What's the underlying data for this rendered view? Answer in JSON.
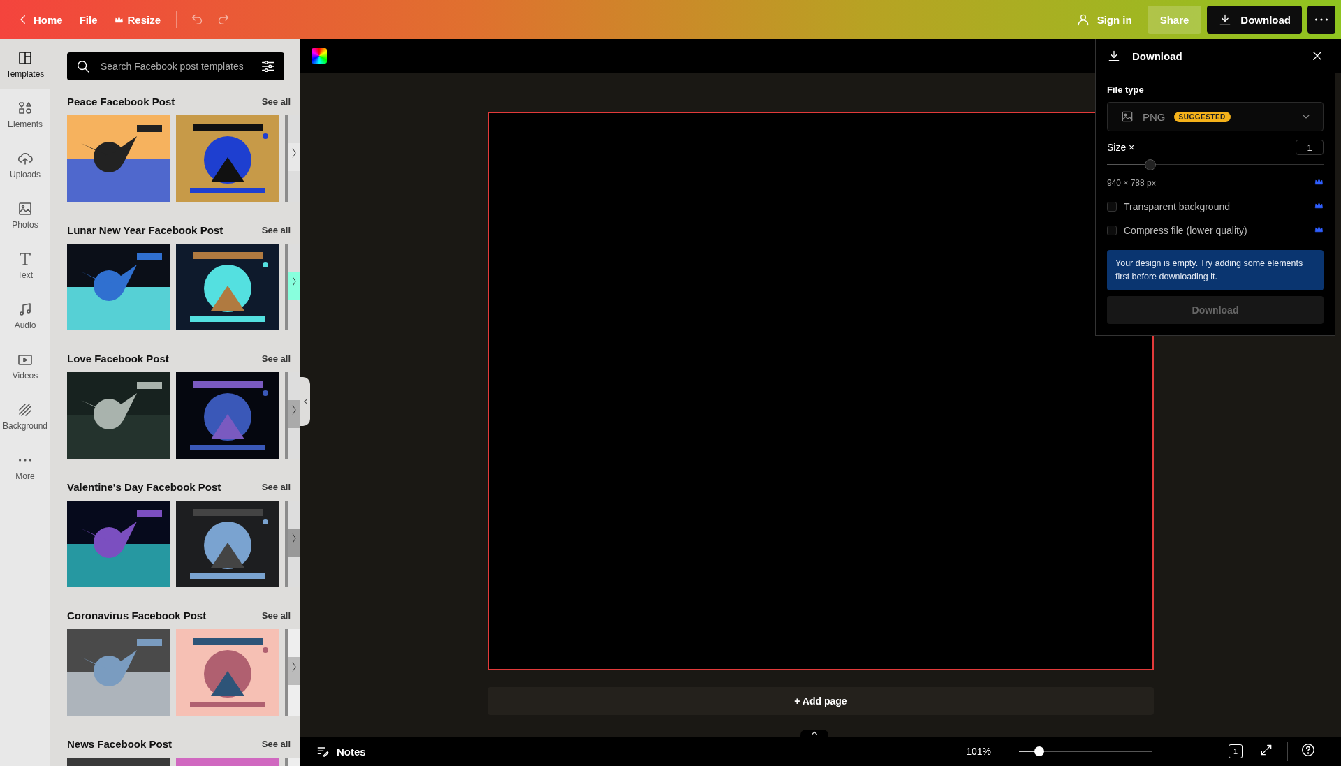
{
  "top_bar": {
    "nav": [
      {
        "label": "Home",
        "kind": "back"
      },
      {
        "label": "File",
        "kind": "plain"
      },
      {
        "label": "Resize",
        "kind": "crown"
      }
    ],
    "sign_in": "Sign in",
    "share": "Share",
    "download": "Download"
  },
  "side_rail": [
    {
      "label": "Templates",
      "selected": true
    },
    {
      "label": "Elements",
      "selected": false
    },
    {
      "label": "Uploads",
      "selected": false
    },
    {
      "label": "Photos",
      "selected": false
    },
    {
      "label": "Text",
      "selected": false
    },
    {
      "label": "Audio",
      "selected": false
    },
    {
      "label": "Videos",
      "selected": false
    },
    {
      "label": "Background",
      "selected": false
    },
    {
      "label": "More",
      "selected": false
    }
  ],
  "templates_panel": {
    "search": {
      "placeholder": "Search Facebook post templates"
    },
    "sections": [
      {
        "title": "Peace Facebook Post",
        "link": "See all"
      },
      {
        "title": "Lunar New Year Facebook Post",
        "link": "See all"
      },
      {
        "title": "Love Facebook Post",
        "link": "See all"
      },
      {
        "title": "Valentine's Day Facebook Post",
        "link": "See all"
      },
      {
        "title": "Coronavirus Facebook Post",
        "link": "See all"
      },
      {
        "title": "News Facebook Post",
        "link": "See all"
      }
    ]
  },
  "canvas": {
    "add_page": "+ Add page"
  },
  "download_panel": {
    "title": "Download",
    "file_type_label": "File type",
    "file_type": "PNG",
    "badge": "SUGGESTED",
    "size_label": "Size ×",
    "size_value": "1",
    "size_slider": {
      "level": 0.2
    },
    "dimensions": "940 × 788 px",
    "options": [
      {
        "label": "Transparent background",
        "checked": false
      },
      {
        "label": "Compress file (lower quality)",
        "checked": false
      }
    ],
    "notice": "Your design is empty. Try adding some elements first before downloading it.",
    "button": {
      "label": "Download",
      "disabled": true
    }
  },
  "bottom_bar": {
    "notes": "Notes",
    "zoom": "101%",
    "zoom_slider": {
      "level": 0.15
    },
    "page_count": "1"
  }
}
